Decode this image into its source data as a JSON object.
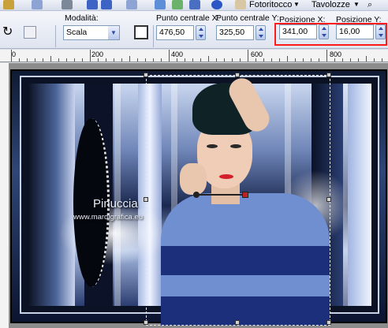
{
  "menu": {
    "fotoritocco": "Fotoritocco",
    "tavolozze": "Tavolozze"
  },
  "options": {
    "mode_label": "Modalità:",
    "mode_value": "Scala",
    "center_x_label": "Punto centrale X:",
    "center_x_value": "476,50",
    "center_y_label": "Punto centrale Y:",
    "center_y_value": "325,50",
    "pos_x_label": "Posizione X:",
    "pos_x_value": "341,00",
    "pos_y_label": "Posizione Y:",
    "pos_y_value": "16,00"
  },
  "ruler": {
    "marks": [
      "0",
      "200",
      "400",
      "600",
      "800"
    ]
  },
  "watermark": {
    "name": "Pinuccia",
    "site": "www.mardigrafica.eu"
  },
  "colors": {
    "highlight": "#ff1b1b",
    "field_border": "#7f9db9"
  }
}
